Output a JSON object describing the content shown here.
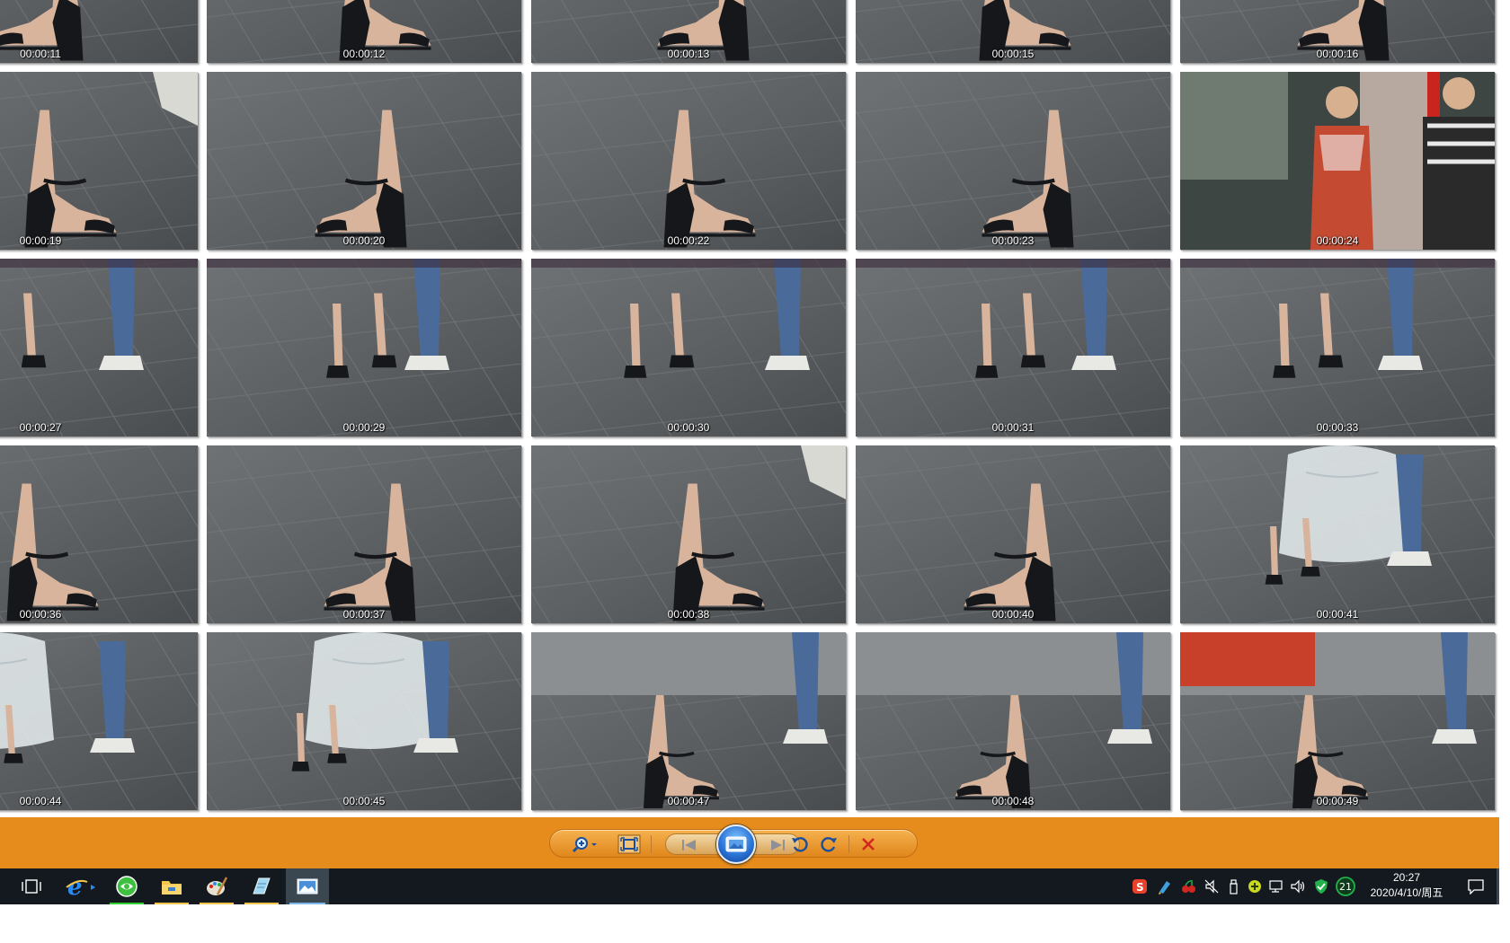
{
  "thumbnails": [
    {
      "time": "00:00:11",
      "scene": "sandal"
    },
    {
      "time": "00:00:12",
      "scene": "sandal"
    },
    {
      "time": "00:00:13",
      "scene": "sandal"
    },
    {
      "time": "00:00:15",
      "scene": "sandal"
    },
    {
      "time": "00:00:16",
      "scene": "sandal"
    },
    {
      "time": "00:00:19",
      "scene": "sandal"
    },
    {
      "time": "00:00:20",
      "scene": "sandal"
    },
    {
      "time": "00:00:22",
      "scene": "sandal"
    },
    {
      "time": "00:00:23",
      "scene": "sandal"
    },
    {
      "time": "00:00:24",
      "scene": "people"
    },
    {
      "time": "00:00:27",
      "scene": "walk"
    },
    {
      "time": "00:00:29",
      "scene": "walk"
    },
    {
      "time": "00:00:30",
      "scene": "walk"
    },
    {
      "time": "00:00:31",
      "scene": "walk"
    },
    {
      "time": "00:00:33",
      "scene": "walk"
    },
    {
      "time": "00:00:36",
      "scene": "sandal"
    },
    {
      "time": "00:00:37",
      "scene": "sandal"
    },
    {
      "time": "00:00:38",
      "scene": "sandal"
    },
    {
      "time": "00:00:40",
      "scene": "sandal"
    },
    {
      "time": "00:00:41",
      "scene": "bag"
    },
    {
      "time": "00:00:44",
      "scene": "bag"
    },
    {
      "time": "00:00:45",
      "scene": "bag"
    },
    {
      "time": "00:00:47",
      "scene": "crowd"
    },
    {
      "time": "00:00:48",
      "scene": "crowd"
    },
    {
      "time": "00:00:49",
      "scene": "crowd"
    }
  ],
  "toolbar": {
    "buttons": [
      {
        "name": "zoom-button",
        "icon": "zoom-in-icon"
      },
      {
        "name": "actual-size-button",
        "icon": "fit-window-icon"
      },
      {
        "name": "previous-button",
        "icon": "skip-previous-icon"
      },
      {
        "name": "slideshow-button",
        "icon": "slideshow-icon"
      },
      {
        "name": "next-button",
        "icon": "skip-next-icon"
      },
      {
        "name": "rotate-left-button",
        "icon": "rotate-ccw-icon"
      },
      {
        "name": "rotate-right-button",
        "icon": "rotate-cw-icon"
      },
      {
        "name": "delete-button",
        "icon": "delete-x-icon"
      }
    ]
  },
  "taskbar": {
    "apps": [
      "task-view-icon",
      "internet-explorer-icon",
      "browser-360-icon",
      "file-explorer-icon",
      "paint-app-icon",
      "notes-app-icon",
      "photo-viewer-icon"
    ],
    "tray": [
      "sogou-ime-icon",
      "pen-tool-icon",
      "cherries-icon",
      "speaker-off-icon",
      "usb-drive-icon",
      "add-green-icon",
      "network-icon",
      "volume-icon",
      "security-shield-icon",
      "battery-badge-icon"
    ],
    "tray_badge": "21",
    "clock_time": "20:27",
    "clock_date": "2020/4/10/周五"
  },
  "colors": {
    "toolbar_bg": "#e58c1c",
    "taskbar_bg": "#13191f",
    "floor": "#5f6366",
    "sandal": "#16171a",
    "skin": "#d9b49c",
    "jeans": "#4a6a9a",
    "delete_red": "#d2261e",
    "tray_green": "#22b14c"
  }
}
